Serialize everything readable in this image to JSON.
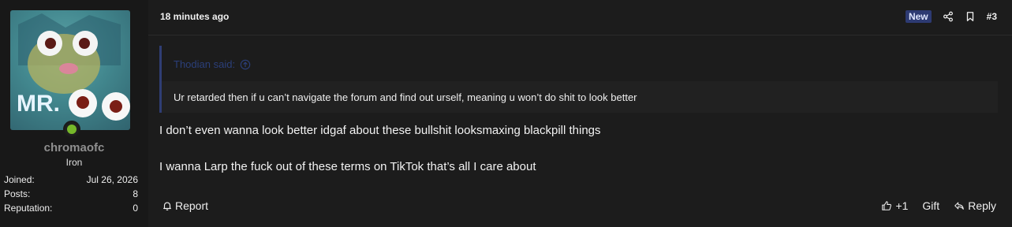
{
  "user": {
    "avatar_text": "MR.",
    "name": "chromaofc",
    "rank": "Iron",
    "stats": [
      {
        "label": "Joined:",
        "value": "Jul 26, 2026"
      },
      {
        "label": "Posts:",
        "value": "8"
      },
      {
        "label": "Reputation:",
        "value": "0"
      }
    ]
  },
  "post": {
    "time": "18 minutes ago",
    "badge": "New",
    "number": "#3",
    "quote": {
      "author": "Thodian said:",
      "text": "Ur retarded then if u can’t navigate the forum and find out urself, meaning u won’t do shit to look better"
    },
    "lines": [
      "I don’t even wanna look better idgaf about these bullshit looksmaxing blackpill things",
      "I wanna Larp the fuck out of these terms on TikTok that’s all I care about"
    ]
  },
  "footer": {
    "report": "Report",
    "like_count": "+1",
    "gift": "Gift",
    "reply": "Reply"
  },
  "colors": {
    "accent": "#2d3a72",
    "online": "#76b82a",
    "background": "#1c1c1c"
  },
  "icons": [
    "share-icon",
    "bookmark-icon",
    "arrow-up-circle-icon",
    "bell-icon",
    "thumbs-up-icon",
    "reply-icon",
    "online-status-icon"
  ]
}
